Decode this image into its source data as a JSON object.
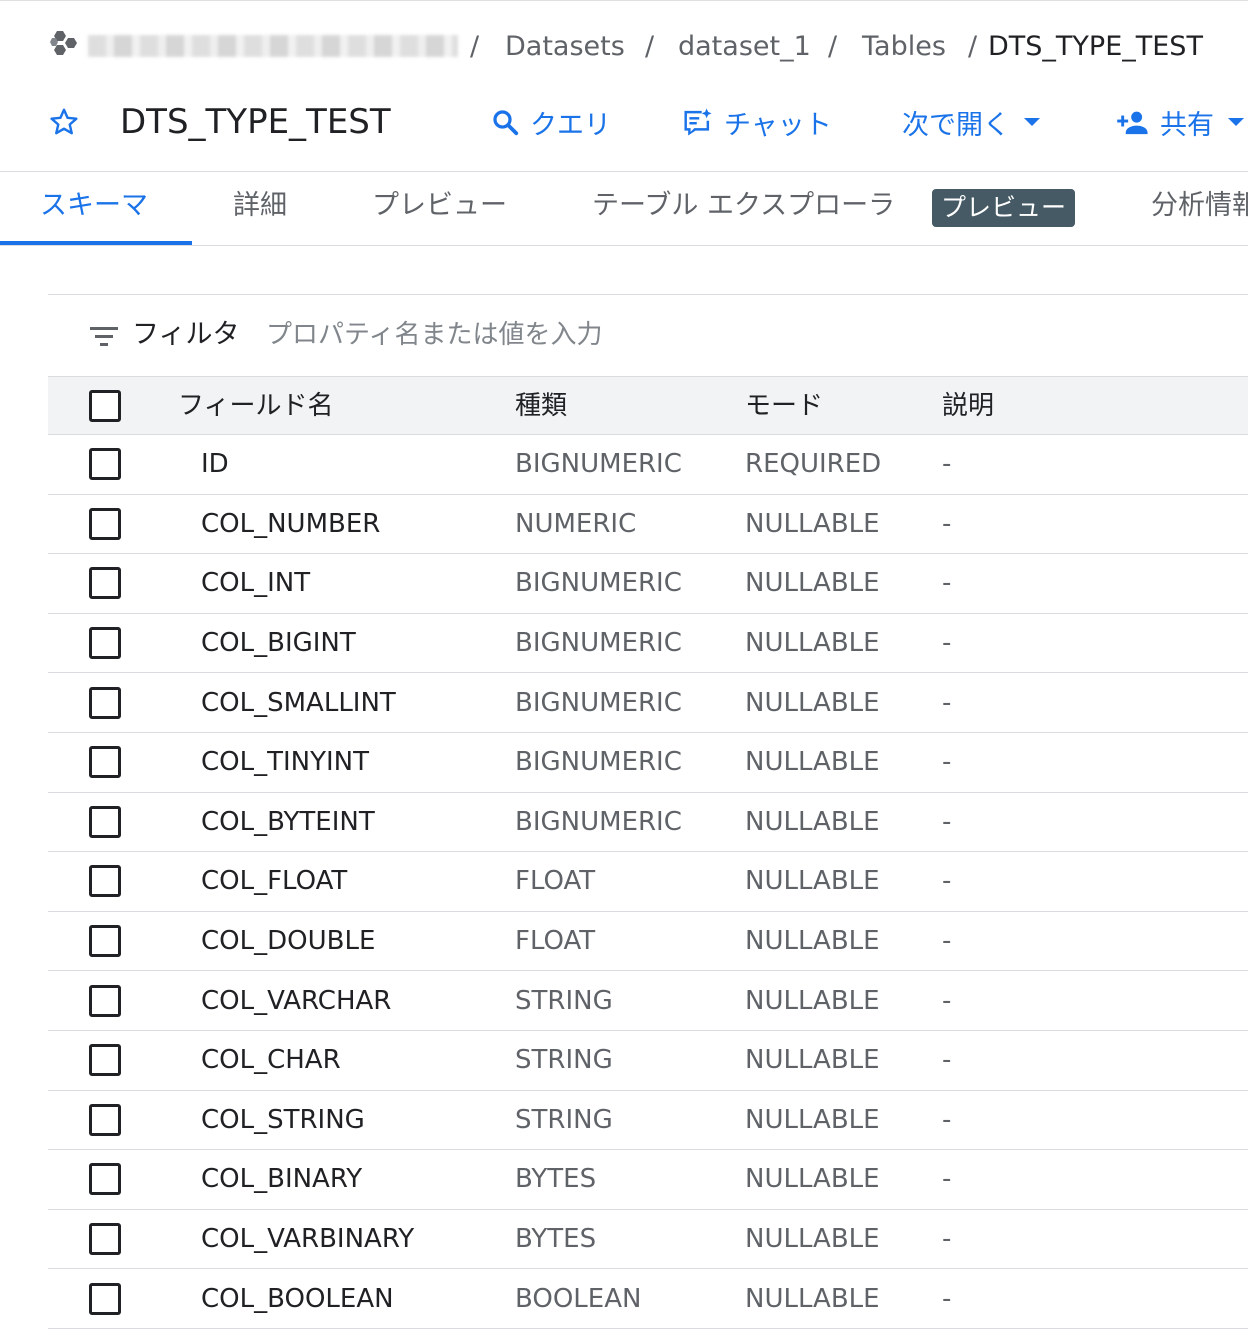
{
  "breadcrumb": {
    "separator": "/",
    "items": [
      "Datasets",
      "dataset_1",
      "Tables"
    ],
    "current": "DTS_TYPE_TEST"
  },
  "header": {
    "title": "DTS_TYPE_TEST",
    "actions": {
      "query": "クエリ",
      "chat": "チャット",
      "open_in": "次で開く",
      "share": "共有"
    }
  },
  "tabs": {
    "schema": "スキーマ",
    "details": "詳細",
    "preview": "プレビュー",
    "table_explorer": "テーブル エクスプローラ",
    "preview_badge": "プレビュー",
    "insights": "分析情報"
  },
  "filter": {
    "label": "フィルタ",
    "placeholder": "プロパティ名または値を入力"
  },
  "table": {
    "headers": {
      "name": "フィールド名",
      "type": "種類",
      "mode": "モード",
      "description": "説明"
    },
    "rows": [
      {
        "name": "ID",
        "type": "BIGNUMERIC",
        "mode": "REQUIRED",
        "description": "-"
      },
      {
        "name": "COL_NUMBER",
        "type": "NUMERIC",
        "mode": "NULLABLE",
        "description": "-"
      },
      {
        "name": "COL_INT",
        "type": "BIGNUMERIC",
        "mode": "NULLABLE",
        "description": "-"
      },
      {
        "name": "COL_BIGINT",
        "type": "BIGNUMERIC",
        "mode": "NULLABLE",
        "description": "-"
      },
      {
        "name": "COL_SMALLINT",
        "type": "BIGNUMERIC",
        "mode": "NULLABLE",
        "description": "-"
      },
      {
        "name": "COL_TINYINT",
        "type": "BIGNUMERIC",
        "mode": "NULLABLE",
        "description": "-"
      },
      {
        "name": "COL_BYTEINT",
        "type": "BIGNUMERIC",
        "mode": "NULLABLE",
        "description": "-"
      },
      {
        "name": "COL_FLOAT",
        "type": "FLOAT",
        "mode": "NULLABLE",
        "description": "-"
      },
      {
        "name": "COL_DOUBLE",
        "type": "FLOAT",
        "mode": "NULLABLE",
        "description": "-"
      },
      {
        "name": "COL_VARCHAR",
        "type": "STRING",
        "mode": "NULLABLE",
        "description": "-"
      },
      {
        "name": "COL_CHAR",
        "type": "STRING",
        "mode": "NULLABLE",
        "description": "-"
      },
      {
        "name": "COL_STRING",
        "type": "STRING",
        "mode": "NULLABLE",
        "description": "-"
      },
      {
        "name": "COL_BINARY",
        "type": "BYTES",
        "mode": "NULLABLE",
        "description": "-"
      },
      {
        "name": "COL_VARBINARY",
        "type": "BYTES",
        "mode": "NULLABLE",
        "description": "-"
      },
      {
        "name": "COL_BOOLEAN",
        "type": "BOOLEAN",
        "mode": "NULLABLE",
        "description": "-"
      }
    ]
  },
  "icons": {
    "logo": "bigquery-hexagons-icon",
    "star": "star-outline-icon",
    "query": "search-icon",
    "chat": "chat-sparkle-icon",
    "share": "person-add-icon",
    "filter": "filter-lines-icon"
  },
  "colors": {
    "accent": "#1a73e8",
    "badge": "#455a64",
    "header_bg": "#f1f3f4",
    "divider": "#dadce0"
  }
}
